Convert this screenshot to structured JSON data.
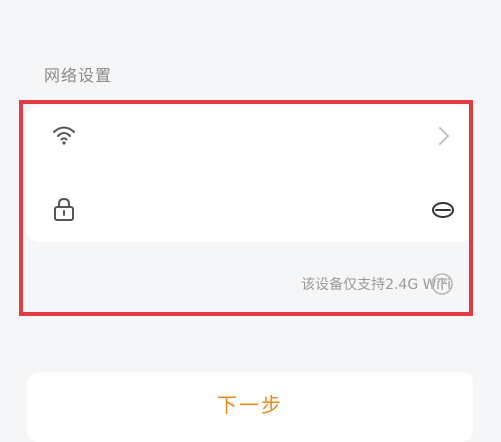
{
  "section": {
    "title": "网络设置"
  },
  "wifi_row": {
    "icon": "wifi-icon",
    "action_icon": "chevron-right-icon"
  },
  "password_row": {
    "icon": "lock-icon",
    "action_icon": "eye-closed-icon"
  },
  "note": {
    "text": "该设备仅支持2.4G WiFi",
    "icon": "help-icon"
  },
  "next_button": {
    "label": "下一步"
  },
  "colors": {
    "background": "#f5f6f8",
    "card": "#ffffff",
    "accent": "#e88a1a",
    "highlight_border": "#e23b45",
    "muted_text": "#9a9a9a"
  }
}
